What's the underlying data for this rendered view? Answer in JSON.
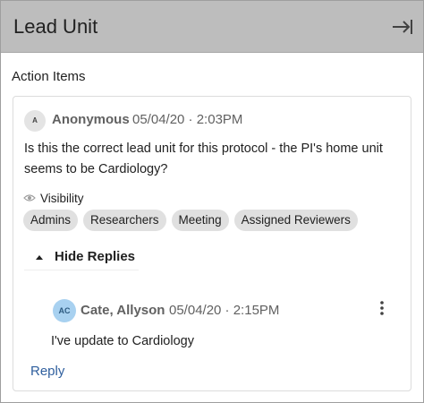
{
  "header": {
    "title": "Lead Unit",
    "collapse_icon": "collapse-right-icon"
  },
  "section": {
    "title": "Action Items"
  },
  "comment": {
    "avatar_initials": "A",
    "author": "Anonymous",
    "timestamp": "05/04/20 · 2:03PM",
    "message": "Is this the correct lead unit for this protocol - the PI's home unit seems to be Cardiology?",
    "visibility_label": "Visibility",
    "visibility_icon": "eye-icon",
    "chips": [
      "Admins",
      "Researchers",
      "Meeting",
      "Assigned Reviewers"
    ],
    "hide_replies_label": "Hide Replies"
  },
  "reply": {
    "avatar_initials": "AC",
    "author": "Cate, Allyson",
    "timestamp": "05/04/20 · 2:15PM",
    "message": "I've update to Cardiology",
    "menu_icon": "kebab-menu-icon"
  },
  "reply_link": "Reply",
  "colors": {
    "header_bg": "#bdbdbd",
    "chip_bg": "#e0e0e0",
    "reply_avatar_bg": "#a8d1f0",
    "link": "#2f5f9e"
  }
}
